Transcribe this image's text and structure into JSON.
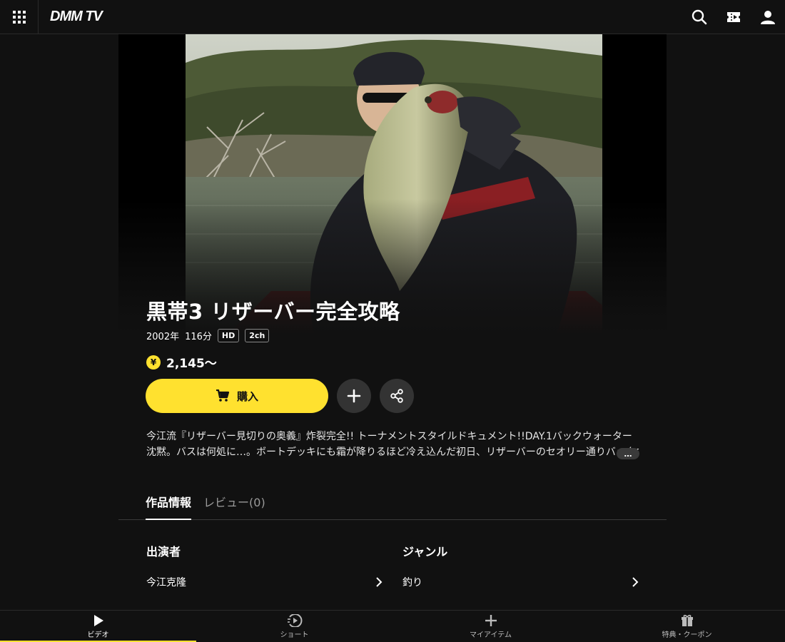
{
  "header": {
    "logo": "DMM TV",
    "icons": [
      "grid-menu-icon",
      "search-icon",
      "ticket-icon",
      "account-icon"
    ]
  },
  "hero": {
    "image_description": "angler holding a large bass on a boat in front of a wooded lakeshore"
  },
  "title": "黒帯3 リザーバー完全攻略",
  "meta": {
    "year": "2002年",
    "duration": "116分",
    "tags": [
      "HD",
      "2ch"
    ]
  },
  "price": {
    "symbol": "¥",
    "value": "2,145〜"
  },
  "actions": {
    "buy_label": "購入",
    "add_icon": "plus-icon",
    "share_icon": "share-icon"
  },
  "description": {
    "line1": "今江流『リザーバー見切りの奥義』炸裂完全!! トーナメントスタイルドキュメント!!DAY.1バックウォーター",
    "line2": "沈黙。バスは何処に…。ボートデッキにも霜が降りるほど冷え込んだ初日、リザーバーのセオリー通りバックウォーター",
    "more_label": "…"
  },
  "tabs": [
    {
      "label": "作品情報",
      "active": true
    },
    {
      "label": "レビュー(0)",
      "active": false
    }
  ],
  "info": {
    "cast": {
      "heading": "出演者",
      "value": "今江克隆"
    },
    "genre": {
      "heading": "ジャンル",
      "value": "釣り"
    }
  },
  "bottom_nav": [
    {
      "label": "ビデオ",
      "icon": "play-icon",
      "active": true
    },
    {
      "label": "ショート",
      "icon": "short-play-icon",
      "active": false
    },
    {
      "label": "マイアイテム",
      "icon": "plus-icon",
      "active": false
    },
    {
      "label": "特典・クーポン",
      "icon": "gift-icon",
      "active": false
    }
  ],
  "colors": {
    "background": "#111111",
    "accent": "#ffe12f",
    "button_dark": "#333333"
  }
}
